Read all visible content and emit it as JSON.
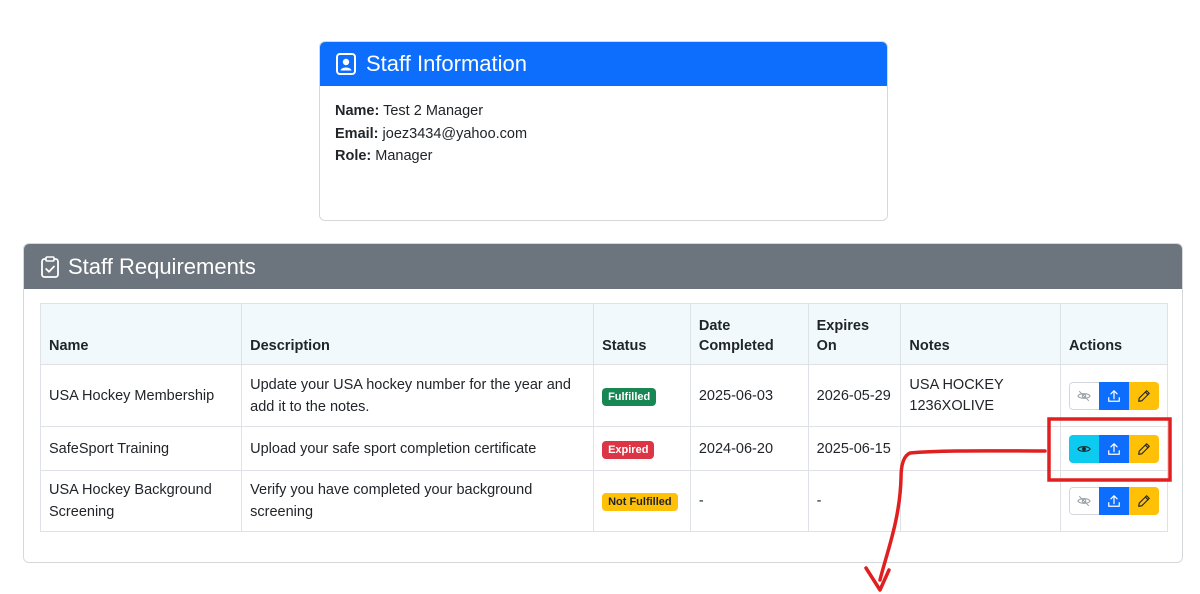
{
  "staff_info": {
    "title": "Staff Information",
    "name_label": "Name:",
    "name_value": "Test 2 Manager",
    "email_label": "Email:",
    "email_value": "joez3434@yahoo.com",
    "role_label": "Role:",
    "role_value": "Manager"
  },
  "requirements": {
    "title": "Staff Requirements",
    "columns": {
      "name": "Name",
      "description": "Description",
      "status": "Status",
      "date_completed_1": "Date",
      "date_completed_2": "Completed",
      "expires_on": "Expires On",
      "notes": "Notes",
      "actions": "Actions"
    },
    "rows": [
      {
        "name": "USA Hockey Membership",
        "description": "Update your USA hockey number for the year and add it to the notes.",
        "status": "Fulfilled",
        "date_completed": "2025-06-03",
        "expires_on": "2026-05-29",
        "notes": "USA HOCKEY 1236XOLIVE"
      },
      {
        "name": "SafeSport Training",
        "description": "Upload your safe sport completion certificate",
        "status": "Expired",
        "date_completed": "2024-06-20",
        "expires_on": "2025-06-15",
        "notes": ""
      },
      {
        "name": "USA Hockey Background Screening",
        "description": "Verify you have completed your background screening",
        "status": "Not Fulfilled",
        "date_completed": "-",
        "expires_on": "-",
        "notes": ""
      }
    ]
  },
  "icons": {
    "staff_info_header": "id-badge-icon",
    "requirements_header": "clipboard-check-icon",
    "view": "eye-icon",
    "view_disabled": "eye-slash-icon",
    "upload": "upload-icon",
    "edit": "pencil-icon"
  },
  "colors": {
    "primary": "#0d6efd",
    "secondary": "#6c757d",
    "success": "#198754",
    "danger": "#dc3545",
    "warning": "#ffc107",
    "info": "#0dcaf0",
    "annotation": "#e02020"
  }
}
